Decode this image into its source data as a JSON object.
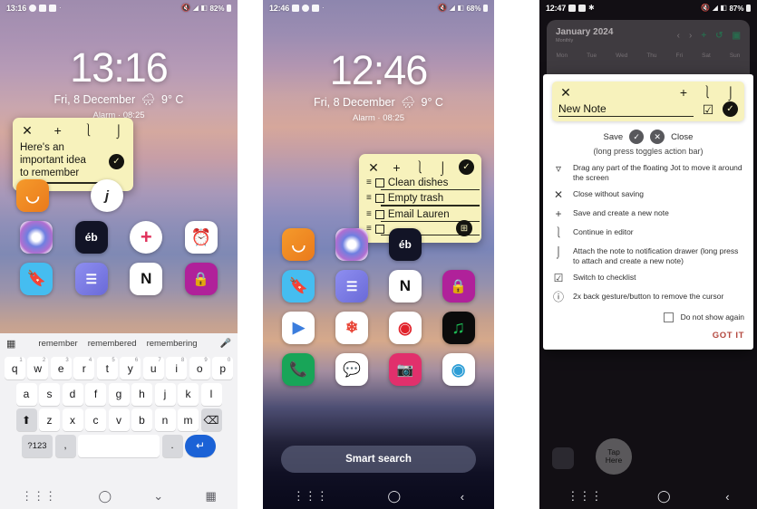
{
  "panels": [
    {
      "id": "phone-1-lockscreen-note",
      "status": {
        "time": "13:16",
        "battery": "82%",
        "icons": [
          "alarm-icon",
          "camera-icon",
          "gallery-icon",
          "dot-icon"
        ],
        "right_icons": [
          "mute-icon",
          "wifi-icon",
          "signal-icon"
        ]
      },
      "clock": {
        "time": "13:16",
        "date": "Fri, 8 December",
        "weather": "9° C",
        "alarm": "Alarm · 08:25"
      },
      "note": {
        "toolbar": [
          "close-icon",
          "add-icon",
          "open-editor-icon",
          "pin-to-notification-icon"
        ],
        "text": "Here's an\nimportant idea\nto remember",
        "text_lines": [
          "Here's an",
          "important idea",
          "to remember"
        ],
        "save_label": "save-check"
      },
      "apps": [
        [
          {
            "label": "audible",
            "color": "#f08020"
          },
          {
            "label": "j",
            "color": "#ffffff"
          }
        ],
        [
          {
            "label": "copilot",
            "color": "#ffffff"
          },
          {
            "label": "eb",
            "color": "#121426"
          },
          {
            "label": "plus",
            "color": "#ffffff"
          },
          {
            "label": "clock",
            "color": "#ffffff"
          }
        ],
        [
          {
            "label": "bookmark",
            "color": "#45bdf0"
          },
          {
            "label": "audio",
            "color": "#7b7fe0"
          },
          {
            "label": "notion",
            "color": "#ffffff"
          },
          {
            "label": "lock",
            "color": "#b0219a"
          }
        ]
      ],
      "keyboard": {
        "suggestions": [
          "remember",
          "remembered",
          "remembering"
        ],
        "left_icon": "keyboard-grid-icon",
        "right_icon": "microphone-icon",
        "row1": [
          {
            "k": "q",
            "n": "1"
          },
          {
            "k": "w",
            "n": "2"
          },
          {
            "k": "e",
            "n": "3"
          },
          {
            "k": "r",
            "n": "4"
          },
          {
            "k": "t",
            "n": "5"
          },
          {
            "k": "y",
            "n": "6"
          },
          {
            "k": "u",
            "n": "7"
          },
          {
            "k": "i",
            "n": "8"
          },
          {
            "k": "o",
            "n": "9"
          },
          {
            "k": "p",
            "n": "0"
          }
        ],
        "row2": [
          "a",
          "s",
          "d",
          "f",
          "g",
          "h",
          "j",
          "k",
          "l"
        ],
        "row3": [
          "z",
          "x",
          "c",
          "v",
          "b",
          "n",
          "m"
        ],
        "shift": "shift-icon",
        "backspace": "backspace-icon",
        "numkey": "?123",
        "comma": ",",
        "period": ".",
        "enter": "enter-icon",
        "space": ""
      },
      "nav": [
        "recents-icon",
        "home-icon",
        "hide-keyboard-icon",
        "keyboard-switch-icon"
      ]
    },
    {
      "id": "phone-2-lockscreen-checklist",
      "status": {
        "time": "12:46",
        "battery": "68%",
        "icons": [
          "camera-icon",
          "alarm-icon",
          "gallery-icon",
          "dot-icon"
        ],
        "right_icons": [
          "mute-icon",
          "wifi-icon",
          "signal-icon"
        ]
      },
      "clock": {
        "time": "12:46",
        "date": "Fri, 8 December",
        "weather": "9° C",
        "alarm": "Alarm · 08:25"
      },
      "note": {
        "toolbar": [
          "close-icon",
          "add-icon",
          "open-editor-icon",
          "pin-to-notification-icon",
          "save-check-icon"
        ],
        "checklist": [
          {
            "text": "Clean dishes",
            "checked": false
          },
          {
            "text": "Empty trash",
            "checked": false
          },
          {
            "text": "Email Lauren",
            "checked": false
          },
          {
            "text": "",
            "checked": false
          }
        ],
        "add_button": "add-item-icon"
      },
      "apps": [
        [
          {
            "label": "audible",
            "color": "#f08020"
          },
          {
            "label": "copilot",
            "color": "#ffffff"
          },
          {
            "label": "eb",
            "color": "#121426"
          }
        ],
        [
          {
            "label": "bookmark",
            "color": "#45bdf0"
          },
          {
            "label": "audio",
            "color": "#7b7fe0"
          },
          {
            "label": "notion",
            "color": "#ffffff"
          },
          {
            "label": "lock",
            "color": "#b0219a"
          }
        ],
        [
          {
            "label": "play-store",
            "color": "#ffffff"
          },
          {
            "label": "photos",
            "color": "#ffffff"
          },
          {
            "label": "youtube-music",
            "color": "#ffffff"
          },
          {
            "label": "spotify",
            "color": "#111111"
          }
        ],
        [
          {
            "label": "phone",
            "color": "#18a558"
          },
          {
            "label": "messages",
            "color": "#ffffff"
          },
          {
            "label": "instagram",
            "color": "#e1306c"
          },
          {
            "label": "edge",
            "color": "#ffffff"
          }
        ]
      ],
      "search": {
        "label": "Smart search"
      },
      "nav": [
        "recents-icon",
        "home-icon",
        "back-icon"
      ]
    },
    {
      "id": "phone-3-help-dialog",
      "status": {
        "time": "12:47",
        "battery": "87%",
        "icons": [
          "camera-icon",
          "gallery-icon",
          "bluetooth-icon"
        ],
        "right_icons": [
          "mute-icon",
          "wifi-icon",
          "signal-icon"
        ]
      },
      "calendar": {
        "title": "January 2024",
        "subtitle": "Monthly",
        "controls": [
          "prev-icon",
          "next-icon",
          "add-icon",
          "sync-icon",
          "calendar-icon"
        ],
        "weekdays": [
          "Mon",
          "Tue",
          "Wed",
          "Thu",
          "Fri",
          "Sat",
          "Sun"
        ]
      },
      "dialog": {
        "jot": {
          "toolbar_top": [
            "close-icon",
            "add-icon",
            "open-editor-icon",
            "pin-to-notification-icon"
          ],
          "title": "New Note",
          "checklist_icon": "checklist-icon",
          "save_icon": "save-check-icon"
        },
        "save_label": "Save",
        "close_label": "Close",
        "hint": "(long press toggles action bar)",
        "items": [
          {
            "icon": "drag-handle-icon",
            "text": "Drag any part of the floating Jot to move it around the screen"
          },
          {
            "icon": "close-icon",
            "text": "Close without saving"
          },
          {
            "icon": "add-icon",
            "text": "Save and create a new note"
          },
          {
            "icon": "open-editor-icon",
            "text": "Continue in editor"
          },
          {
            "icon": "pin-to-notification-icon",
            "text": "Attach the note to notification drawer (long press to attach and create a new note)"
          },
          {
            "icon": "checklist-icon",
            "text": "Switch to checklist"
          },
          {
            "icon": "info-icon",
            "text": "2x back gesture/button to remove the cursor"
          }
        ],
        "do_not_show_label": "Do not show again",
        "got_it_label": "GOT IT"
      },
      "tap_here": {
        "label": "Tap\nHere",
        "line1": "Tap",
        "line2": "Here"
      },
      "nav": [
        "recents-icon",
        "home-icon",
        "back-icon"
      ]
    }
  ],
  "colors": {
    "note_yellow": "#f7f2bc",
    "accent_red": "#b4483f",
    "enter_blue": "#1b62d6",
    "calendar_green": "#2f7d5a"
  }
}
